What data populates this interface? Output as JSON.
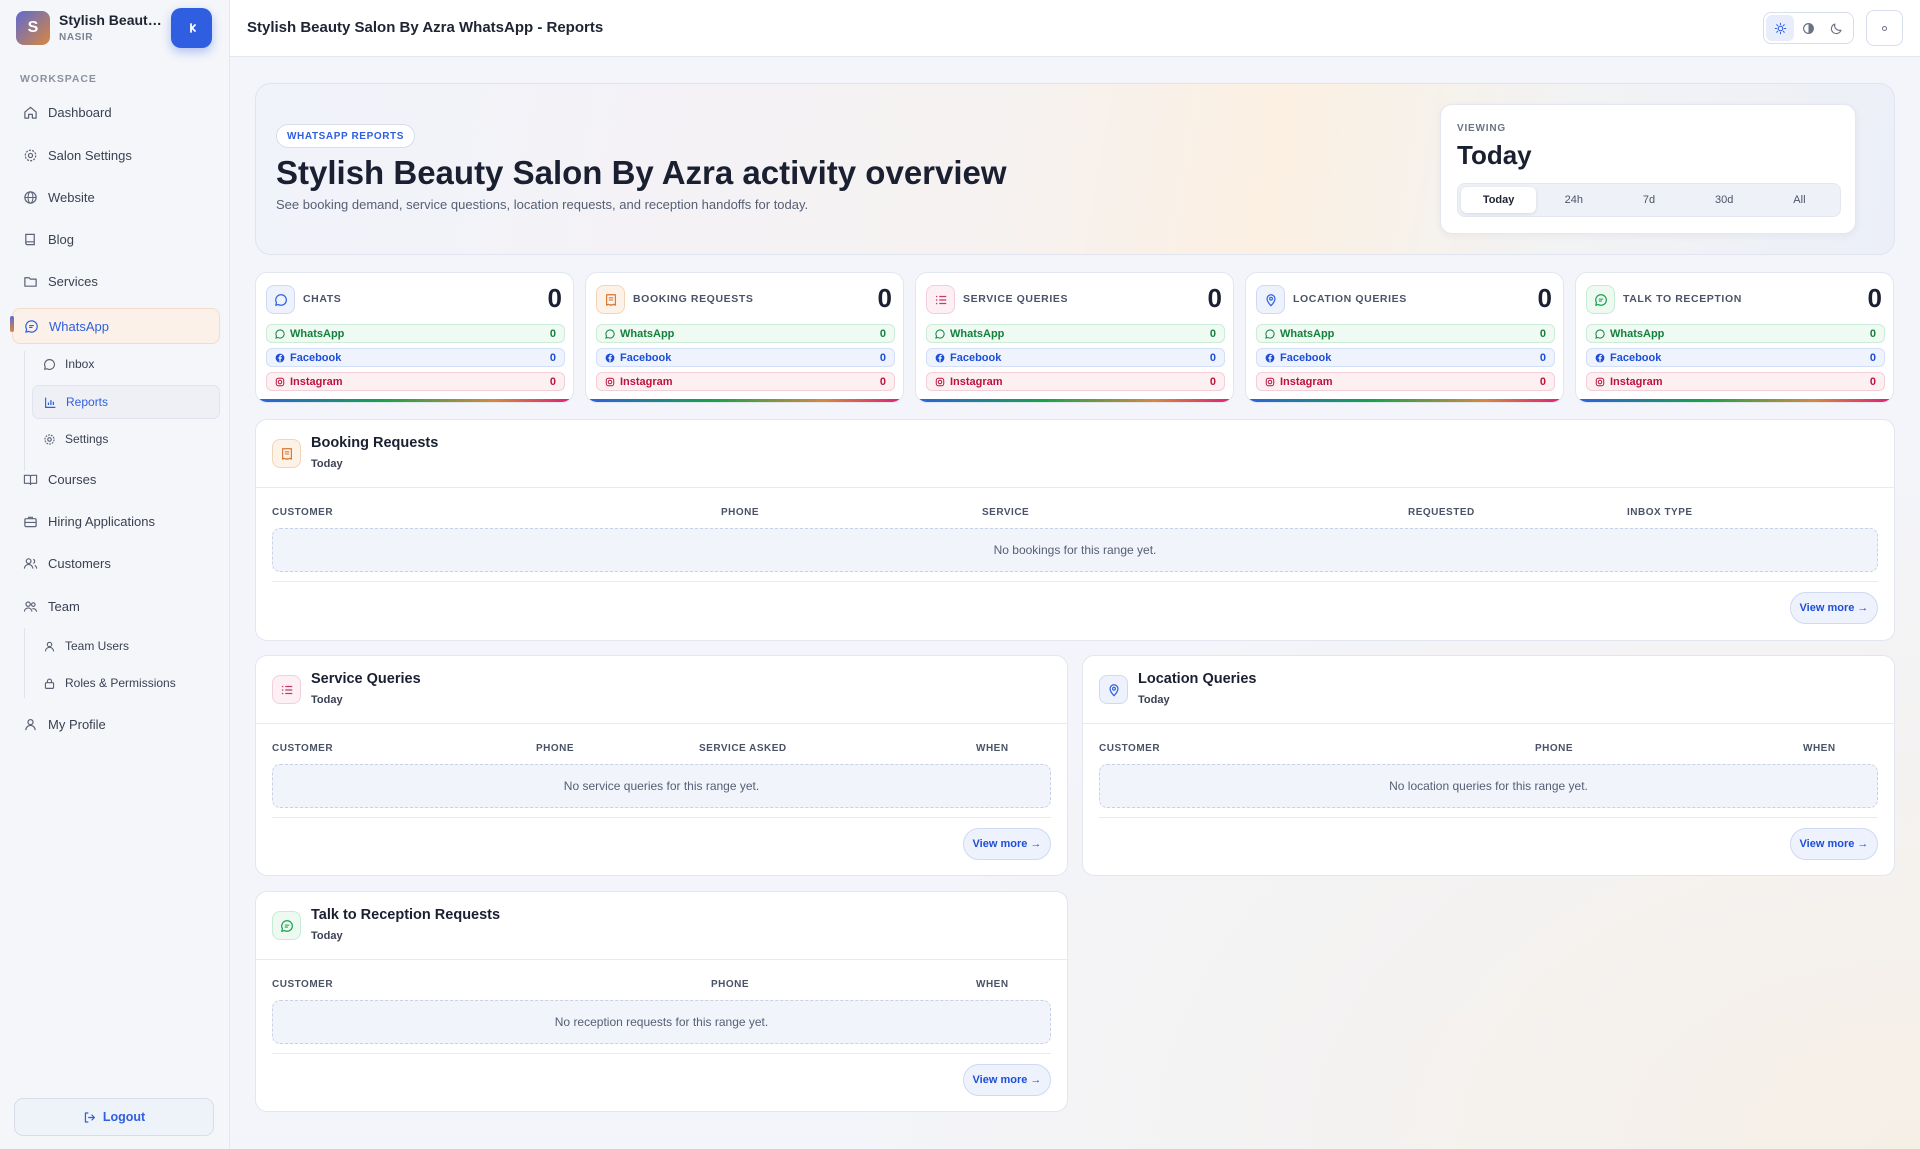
{
  "app": {
    "brand_initial": "S",
    "brand_name": "Stylish Beauty Salon By Azra",
    "brand_sub": "NASIR",
    "page_title": "Stylish Beauty Salon By Azra WhatsApp - Reports"
  },
  "sidebar": {
    "section_label": "WORKSPACE",
    "items": [
      {
        "label": "Dashboard",
        "icon": "home-icon"
      },
      {
        "label": "Salon Settings",
        "icon": "gear-icon"
      },
      {
        "label": "Website",
        "icon": "globe-icon"
      },
      {
        "label": "Blog",
        "icon": "book-icon"
      },
      {
        "label": "Services",
        "icon": "folder-icon"
      },
      {
        "label": "WhatsApp",
        "icon": "chat-icon",
        "active": true
      },
      {
        "label": "Courses",
        "icon": "open-book-icon"
      },
      {
        "label": "Hiring Applications",
        "icon": "briefcase-icon"
      },
      {
        "label": "Customers",
        "icon": "users-icon"
      },
      {
        "label": "Team",
        "icon": "team-icon"
      },
      {
        "label": "My Profile",
        "icon": "user-icon"
      }
    ],
    "whatsapp_sub": [
      {
        "label": "Inbox",
        "icon": "chat-bubble-icon"
      },
      {
        "label": "Reports",
        "icon": "bar-chart-icon",
        "active": true
      },
      {
        "label": "Settings",
        "icon": "gear-icon"
      }
    ],
    "team_sub": [
      {
        "label": "Team Users",
        "icon": "user-icon"
      },
      {
        "label": "Roles & Permissions",
        "icon": "lock-icon"
      }
    ],
    "logout_label": "Logout"
  },
  "theme": {
    "options": [
      "light",
      "contrast",
      "dark"
    ],
    "selected": "light"
  },
  "hero": {
    "tag": "WHATSAPP REPORTS",
    "title": "Stylish Beauty Salon By Azra activity overview",
    "subtitle": "See booking demand, service questions, location requests, and reception handoffs for today.",
    "viewing_label": "VIEWING",
    "viewing_value": "Today",
    "ranges": [
      "Today",
      "24h",
      "7d",
      "30d",
      "All"
    ],
    "selected_range": "Today"
  },
  "stats": [
    {
      "label": "CHATS",
      "total": "0",
      "whatsapp": "0",
      "facebook": "0",
      "instagram": "0",
      "icon": "chat-icon",
      "tone": "blue"
    },
    {
      "label": "BOOKING REQUESTS",
      "total": "0",
      "whatsapp": "0",
      "facebook": "0",
      "instagram": "0",
      "icon": "receipt-icon",
      "tone": "orange"
    },
    {
      "label": "SERVICE QUERIES",
      "total": "0",
      "whatsapp": "0",
      "facebook": "0",
      "instagram": "0",
      "icon": "list-icon",
      "tone": "pink"
    },
    {
      "label": "LOCATION QUERIES",
      "total": "0",
      "whatsapp": "0",
      "facebook": "0",
      "instagram": "0",
      "icon": "map-pin-icon",
      "tone": "blue"
    },
    {
      "label": "TALK TO RECEPTION",
      "total": "0",
      "whatsapp": "0",
      "facebook": "0",
      "instagram": "0",
      "icon": "chat-lines-icon",
      "tone": "green"
    }
  ],
  "channels": {
    "whatsapp": "WhatsApp",
    "facebook": "Facebook",
    "instagram": "Instagram"
  },
  "panels": {
    "booking": {
      "title": "Booking Requests",
      "subtitle": "Today",
      "columns": [
        "CUSTOMER",
        "PHONE",
        "SERVICE",
        "REQUESTED",
        "INBOX TYPE"
      ],
      "empty": "No bookings for this range yet.",
      "view_more": "View more →"
    },
    "service": {
      "title": "Service Queries",
      "subtitle": "Today",
      "columns": [
        "CUSTOMER",
        "PHONE",
        "SERVICE ASKED",
        "WHEN"
      ],
      "empty": "No service queries for this range yet.",
      "view_more": "View more →"
    },
    "location": {
      "title": "Location Queries",
      "subtitle": "Today",
      "columns": [
        "CUSTOMER",
        "PHONE",
        "WHEN"
      ],
      "empty": "No location queries for this range yet.",
      "view_more": "View more →"
    },
    "reception": {
      "title": "Talk to Reception Requests",
      "subtitle": "Today",
      "columns": [
        "CUSTOMER",
        "PHONE",
        "WHEN"
      ],
      "empty": "No reception requests for this range yet.",
      "view_more": "View more →"
    }
  },
  "colors": {
    "accent": "#2f5fe0",
    "brand_orange": "#d8873e",
    "whatsapp": "#15803d",
    "facebook": "#1d4ed8",
    "instagram": "#be123c"
  }
}
